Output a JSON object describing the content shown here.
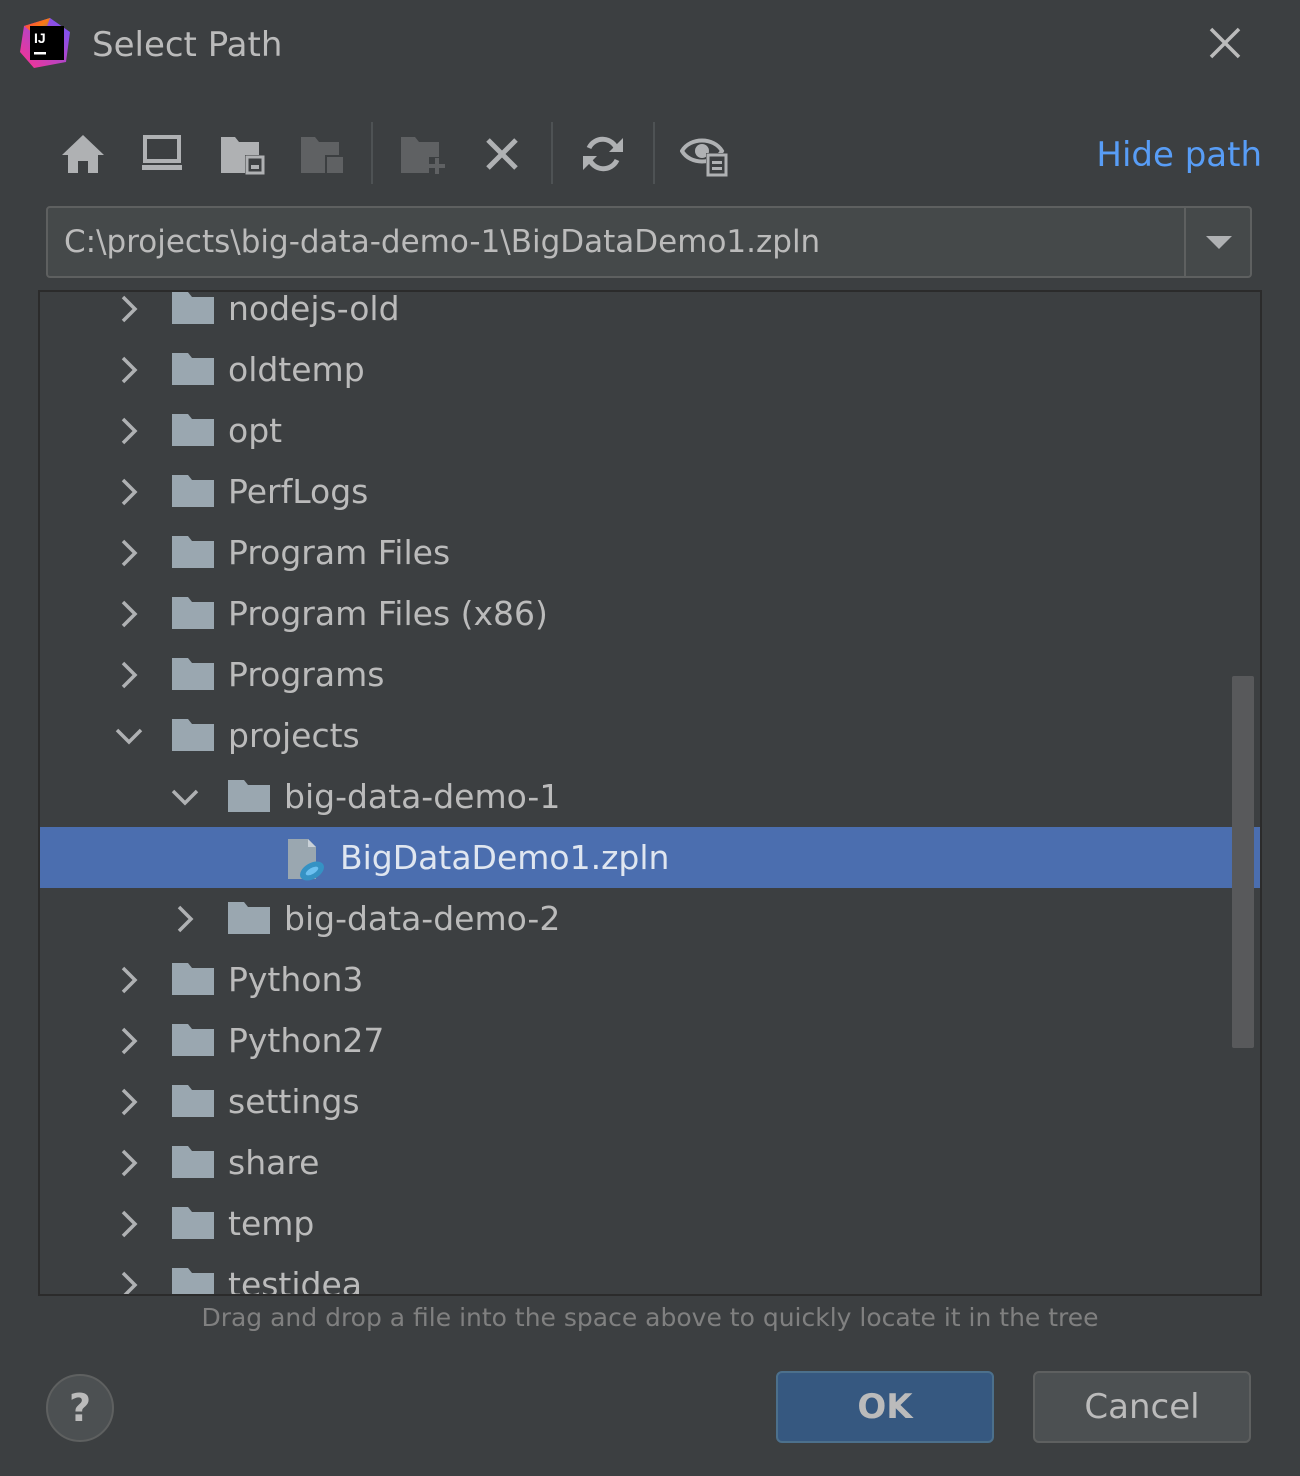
{
  "window": {
    "title": "Select Path",
    "app_logo_text": "IJ"
  },
  "toolbar": {
    "hide_path_label": "Hide path"
  },
  "path": {
    "value": "C:\\projects\\big-data-demo-1\\BigDataDemo1.zpln"
  },
  "tree": {
    "rows": [
      {
        "label": "nodejs-old",
        "depth": 0,
        "expanded": false,
        "type": "folder"
      },
      {
        "label": "oldtemp",
        "depth": 0,
        "expanded": false,
        "type": "folder"
      },
      {
        "label": "opt",
        "depth": 0,
        "expanded": false,
        "type": "folder"
      },
      {
        "label": "PerfLogs",
        "depth": 0,
        "expanded": false,
        "type": "folder"
      },
      {
        "label": "Program Files",
        "depth": 0,
        "expanded": false,
        "type": "folder"
      },
      {
        "label": "Program Files (x86)",
        "depth": 0,
        "expanded": false,
        "type": "folder"
      },
      {
        "label": "Programs",
        "depth": 0,
        "expanded": false,
        "type": "folder"
      },
      {
        "label": "projects",
        "depth": 0,
        "expanded": true,
        "type": "folder"
      },
      {
        "label": "big-data-demo-1",
        "depth": 1,
        "expanded": true,
        "type": "folder"
      },
      {
        "label": "BigDataDemo1.zpln",
        "depth": 2,
        "type": "file",
        "selected": true
      },
      {
        "label": "big-data-demo-2",
        "depth": 1,
        "expanded": false,
        "type": "folder"
      },
      {
        "label": "Python3",
        "depth": 0,
        "expanded": false,
        "type": "folder"
      },
      {
        "label": "Python27",
        "depth": 0,
        "expanded": false,
        "type": "folder"
      },
      {
        "label": "settings",
        "depth": 0,
        "expanded": false,
        "type": "folder"
      },
      {
        "label": "share",
        "depth": 0,
        "expanded": false,
        "type": "folder"
      },
      {
        "label": "temp",
        "depth": 0,
        "expanded": false,
        "type": "folder"
      },
      {
        "label": "testidea",
        "depth": 0,
        "expanded": false,
        "type": "folder"
      }
    ]
  },
  "hint": "Drag and drop a file into the space above to quickly locate it in the tree",
  "buttons": {
    "help": "?",
    "ok": "OK",
    "cancel": "Cancel"
  },
  "colors": {
    "background": "#3c3f41",
    "selection": "#4b6eaf",
    "link": "#589df6",
    "ok_button": "#365880"
  }
}
